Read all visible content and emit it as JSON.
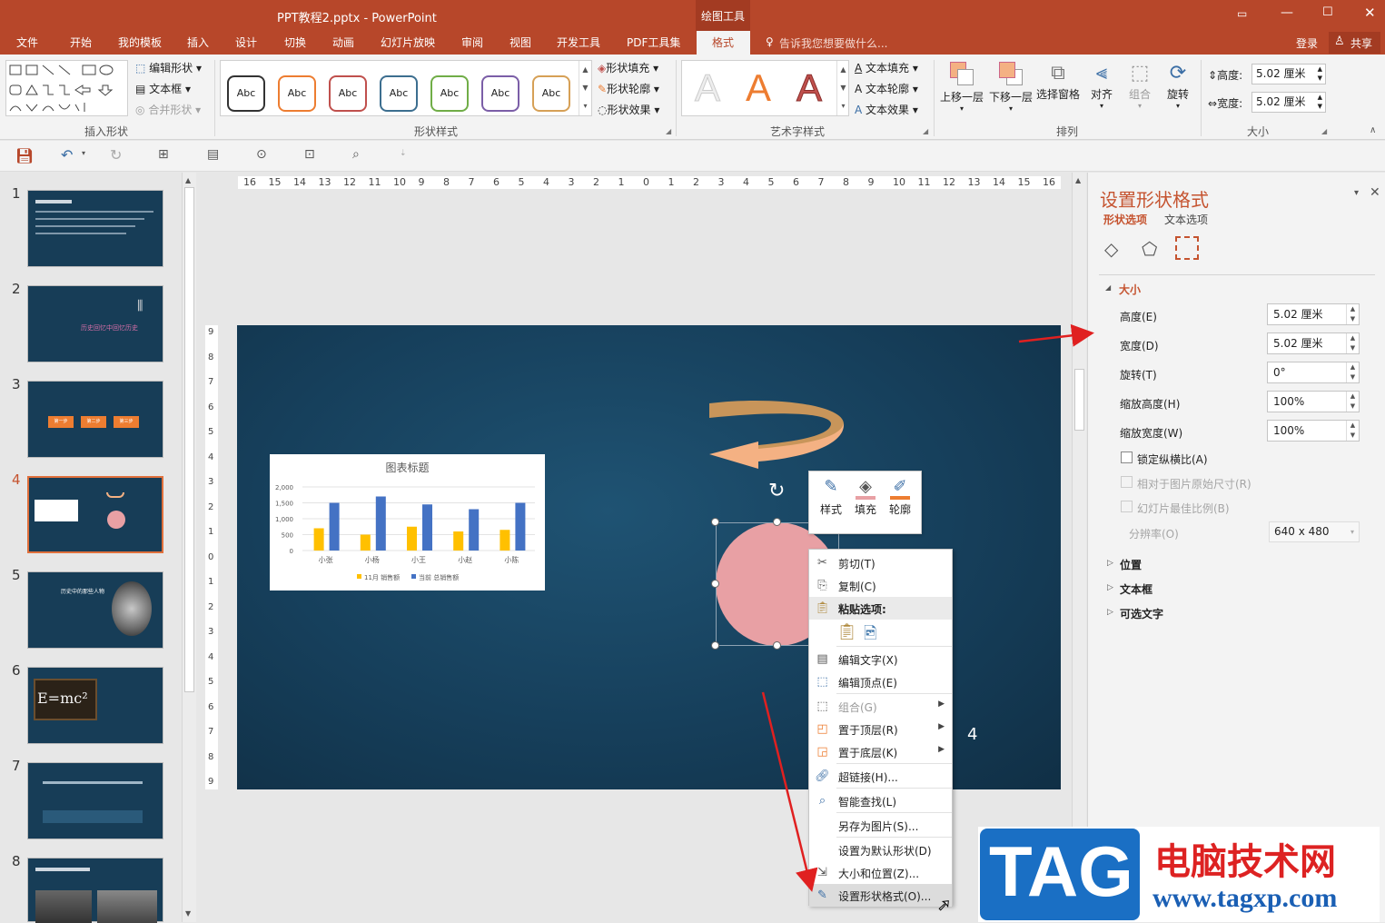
{
  "titlebar": {
    "title": "PPT教程2.pptx - PowerPoint",
    "context_tab": "绘图工具"
  },
  "tabs": [
    "文件",
    "开始",
    "我的模板",
    "插入",
    "设计",
    "切换",
    "动画",
    "幻灯片放映",
    "审阅",
    "视图",
    "开发工具",
    "PDF工具集",
    "格式"
  ],
  "tell_me": "告诉我您想要做什么...",
  "login": "登录",
  "share": "共享",
  "ribbon": {
    "insert_shape": {
      "edit_shape": "编辑形状",
      "text_box": "文本框",
      "merge_shape": "合并形状",
      "label": "插入形状"
    },
    "shape_styles": {
      "abc": "Abc",
      "fill": "形状填充",
      "outline": "形状轮廓",
      "effect": "形状效果",
      "label": "形状样式",
      "colors": [
        "#333333",
        "#ed7d31",
        "#c0504d",
        "#3c6e8f",
        "#70ad47",
        "#7b5ea7",
        "#d6a056"
      ]
    },
    "wordart": {
      "sample": "A",
      "text_fill": "文本填充",
      "text_outline": "文本轮廓",
      "text_effect": "文本效果",
      "label": "艺术字样式"
    },
    "arrange": {
      "bring_forward": "上移一层",
      "send_backward": "下移一层",
      "selection_pane": "选择窗格",
      "align": "对齐",
      "group": "组合",
      "rotate": "旋转",
      "label": "排列"
    },
    "size": {
      "height_label": "高度:",
      "height": "5.02 厘米",
      "width_label": "宽度:",
      "width": "5.02 厘米",
      "label": "大小"
    }
  },
  "thumbs": [
    "1",
    "2",
    "3",
    "4",
    "5",
    "6",
    "7",
    "8"
  ],
  "thumb_texts": {
    "s2_title": "历史回忆中回忆历史",
    "s3_steps": [
      "第一步",
      "第二步",
      "第三步"
    ],
    "s5_title": "历史中的那些人物",
    "s6_formula": "E=mc²",
    "s7_text": "",
    "s8_title": ""
  },
  "ruler_h": [
    "16",
    "15",
    "14",
    "13",
    "12",
    "11",
    "10",
    "9",
    "8",
    "7",
    "6",
    "5",
    "4",
    "3",
    "2",
    "1",
    "0",
    "1",
    "2",
    "3",
    "4",
    "5",
    "6",
    "7",
    "8",
    "9",
    "10",
    "11",
    "12",
    "13",
    "14",
    "15",
    "16"
  ],
  "ruler_v": [
    "9",
    "8",
    "7",
    "6",
    "5",
    "4",
    "3",
    "2",
    "1",
    "0",
    "1",
    "2",
    "3",
    "4",
    "5",
    "6",
    "7",
    "8",
    "9"
  ],
  "slide": {
    "page_number": "4"
  },
  "chart_data": {
    "type": "bar",
    "title": "图表标题",
    "categories": [
      "小张",
      "小杨",
      "小王",
      "小赵",
      "小陈"
    ],
    "series": [
      {
        "name": "11月 销售额",
        "color": "#ffc000",
        "values": [
          700,
          500,
          750,
          600,
          650
        ]
      },
      {
        "name": "当前 总销售额",
        "color": "#4472c4",
        "values": [
          1500,
          1700,
          1450,
          1300,
          1500
        ]
      }
    ],
    "yticks": [
      "2,000",
      "1,500",
      "1,000",
      "500",
      "0"
    ],
    "ylim": [
      0,
      2000
    ],
    "legend": "bottom"
  },
  "mini_toolbar": {
    "style": "样式",
    "fill": "填充",
    "outline": "轮廓"
  },
  "context_menu": {
    "cut": "剪切(T)",
    "copy": "复制(C)",
    "paste_options": "粘贴选项:",
    "edit_text": "编辑文字(X)",
    "edit_points": "编辑顶点(E)",
    "group": "组合(G)",
    "bring_front": "置于顶层(R)",
    "send_back": "置于底层(K)",
    "hyperlink": "超链接(H)...",
    "smart_lookup": "智能查找(L)",
    "save_as_picture": "另存为图片(S)...",
    "set_default": "设置为默认形状(D)",
    "size_position": "大小和位置(Z)...",
    "format_shape": "设置形状格式(O)..."
  },
  "panel": {
    "title": "设置形状格式",
    "tab_shape": "形状选项",
    "tab_text": "文本选项",
    "section_size": "大小",
    "height_label": "高度(E)",
    "height": "5.02 厘米",
    "width_label": "宽度(D)",
    "width": "5.02 厘米",
    "rotation_label": "旋转(T)",
    "rotation": "0°",
    "scale_h_label": "缩放高度(H)",
    "scale_h": "100%",
    "scale_w_label": "缩放宽度(W)",
    "scale_w": "100%",
    "lock_ratio": "锁定纵横比(A)",
    "relative_original": "相对于图片原始尺寸(R)",
    "best_scale": "幻灯片最佳比例(B)",
    "resolution_label": "分辨率(O)",
    "resolution": "640 x 480",
    "position": "位置",
    "textbox": "文本框",
    "alt_text": "可选文字"
  },
  "watermark": {
    "tag": "TAG",
    "site_cn": "电脑技术网",
    "url": "www.tagxp.com"
  }
}
